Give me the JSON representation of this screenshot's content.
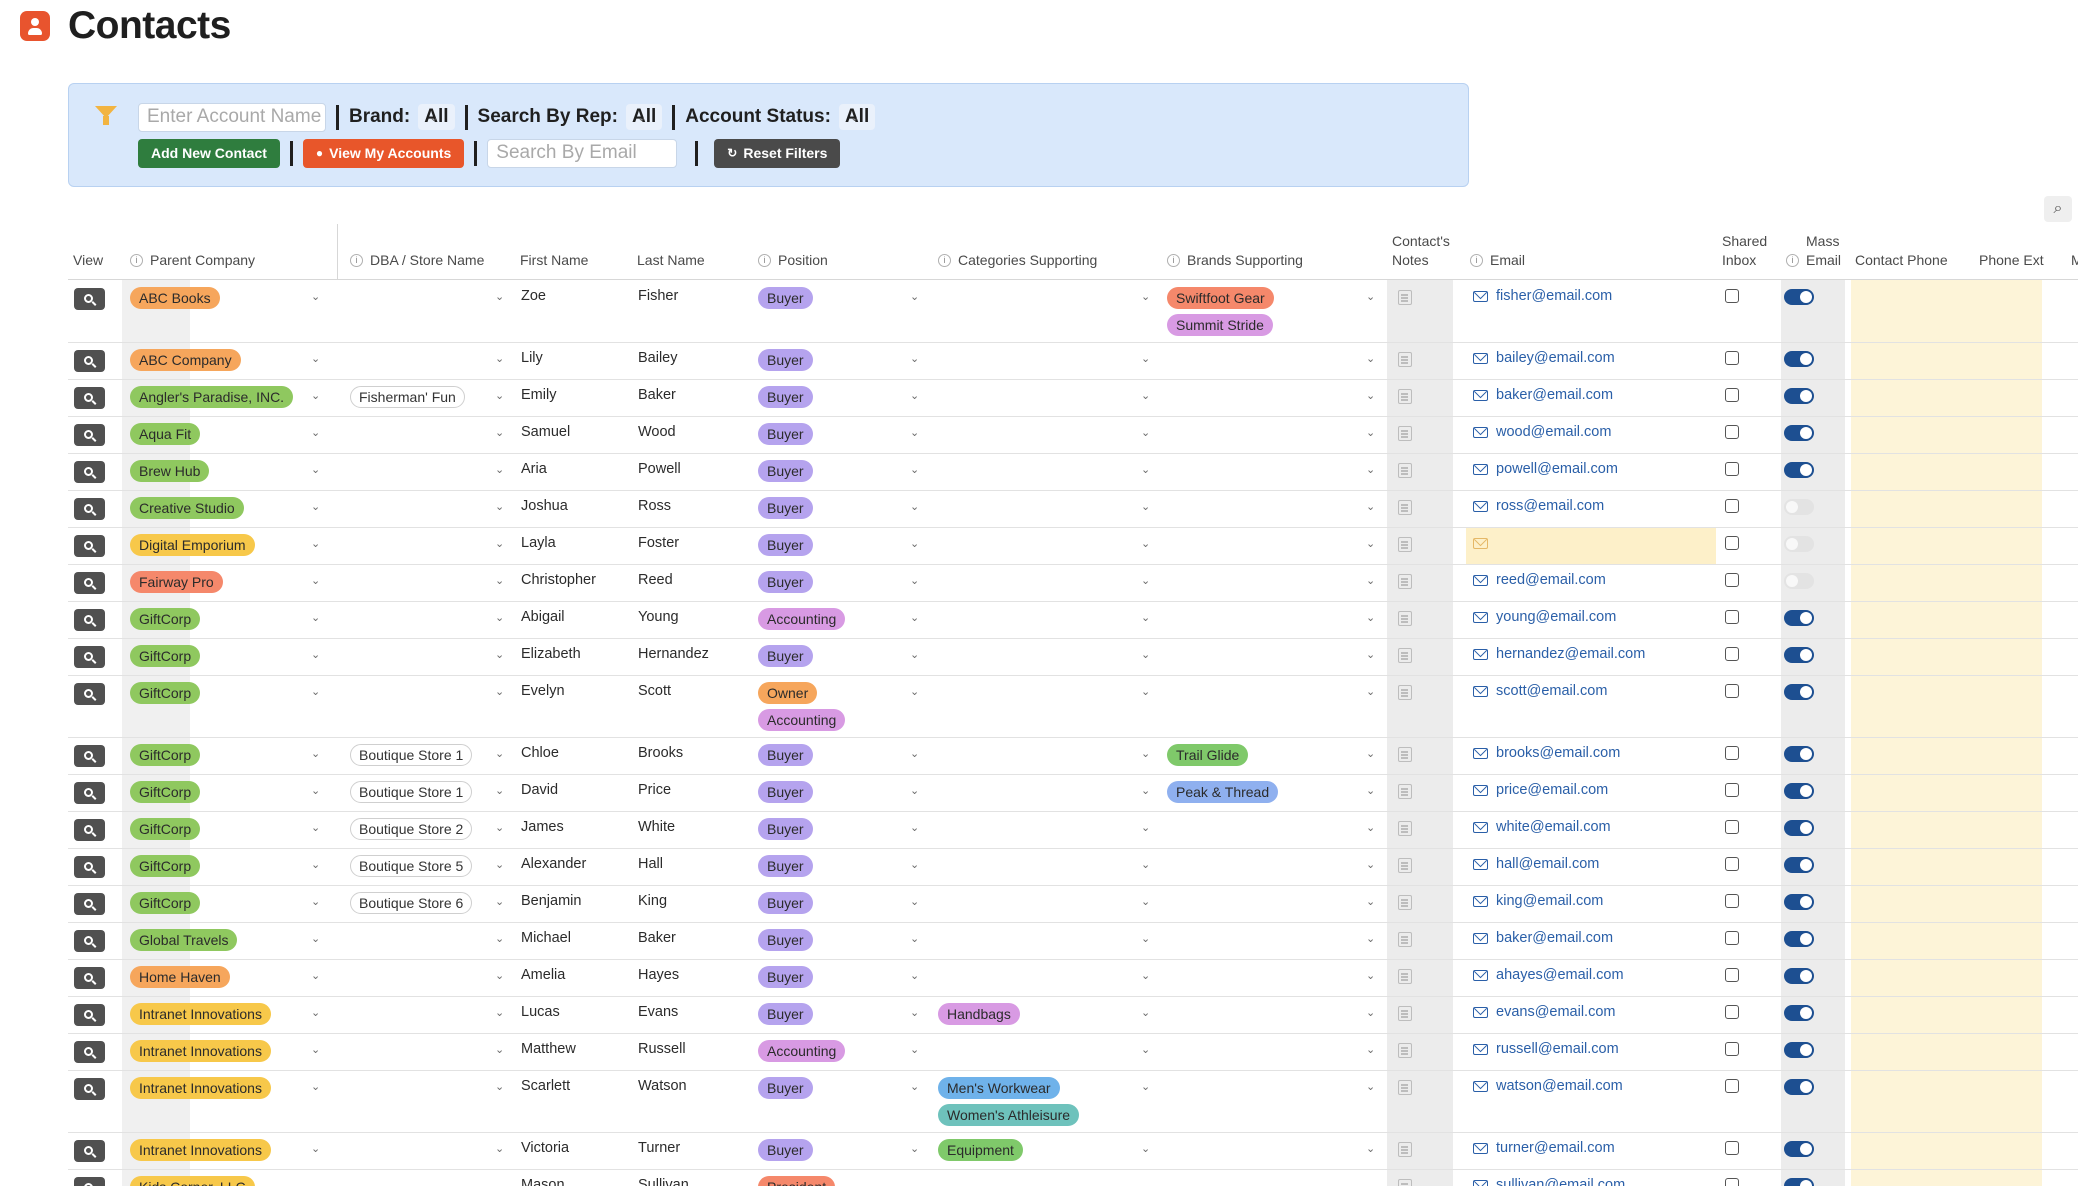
{
  "app": {
    "title": "Contacts",
    "icon": "contact-icon"
  },
  "filters": {
    "account_placeholder": "Enter Account Name",
    "brand_label": "Brand:",
    "brand_value": "All",
    "rep_label": "Search By Rep:",
    "rep_value": "All",
    "status_label": "Account Status:",
    "status_value": "All",
    "add_contact": "Add New Contact",
    "view_accounts": "View My Accounts",
    "email_placeholder": "Search By Email",
    "reset": "Reset Filters"
  },
  "columns": {
    "view": "View",
    "parent": "Parent Company",
    "dba": "DBA / Store Name",
    "first": "First Name",
    "last": "Last Name",
    "position": "Position",
    "categories": "Categories Supporting",
    "brands": "Brands Supporting",
    "notes_1": "Contact's",
    "notes_2": "Notes",
    "email": "Email",
    "shared_1": "Shared",
    "shared_2": "Inbox",
    "mass_1": "Mass",
    "mass_2": "Email",
    "phone": "Contact Phone",
    "ext": "Phone Ext",
    "next": "M"
  },
  "colors": {
    "orange": "#f6a65c",
    "yellow": "#f7c84a",
    "green": "#8fc85f",
    "salmon": "#f5886b",
    "purple": "#b5a3ee",
    "magenta": "#d89ae3",
    "blue": "#8fb0ef",
    "sky": "#6fb2ea",
    "teal": "#6ec2bc",
    "lime": "#7fc96a"
  },
  "rows": [
    {
      "parent": "ABC Books",
      "parent_color": "orange",
      "dba": "",
      "first": "Zoe",
      "last": "Fisher",
      "position": [
        {
          "t": "Buyer",
          "c": "purple"
        }
      ],
      "categories": [],
      "brands": [
        {
          "t": "Swiftfoot Gear",
          "c": "salmon"
        },
        {
          "t": "Summit Stride",
          "c": "magenta"
        }
      ],
      "email": "fisher@email.com",
      "mass": true
    },
    {
      "parent": "ABC Company",
      "parent_color": "orange",
      "dba": "",
      "first": "Lily",
      "last": "Bailey",
      "position": [
        {
          "t": "Buyer",
          "c": "purple"
        }
      ],
      "categories": [],
      "brands": [],
      "email": "bailey@email.com",
      "mass": true
    },
    {
      "parent": "Angler's Paradise, INC.",
      "parent_color": "green",
      "dba": "Fisherman' Fun",
      "first": "Emily",
      "last": "Baker",
      "position": [
        {
          "t": "Buyer",
          "c": "purple"
        }
      ],
      "categories": [],
      "brands": [],
      "email": "baker@email.com",
      "mass": true
    },
    {
      "parent": "Aqua Fit",
      "parent_color": "green",
      "dba": "",
      "first": "Samuel",
      "last": "Wood",
      "position": [
        {
          "t": "Buyer",
          "c": "purple"
        }
      ],
      "categories": [],
      "brands": [],
      "email": "wood@email.com",
      "mass": true
    },
    {
      "parent": "Brew Hub",
      "parent_color": "green",
      "dba": "",
      "first": "Aria",
      "last": "Powell",
      "position": [
        {
          "t": "Buyer",
          "c": "purple"
        }
      ],
      "categories": [],
      "brands": [],
      "email": "powell@email.com",
      "mass": true
    },
    {
      "parent": "Creative Studio",
      "parent_color": "green",
      "dba": "",
      "first": "Joshua",
      "last": "Ross",
      "position": [
        {
          "t": "Buyer",
          "c": "purple"
        }
      ],
      "categories": [],
      "brands": [],
      "email": "ross@email.com",
      "mass": false
    },
    {
      "parent": "Digital Emporium",
      "parent_color": "yellow",
      "dba": "",
      "first": "Layla",
      "last": "Foster",
      "position": [
        {
          "t": "Buyer",
          "c": "purple"
        }
      ],
      "categories": [],
      "brands": [],
      "email": "",
      "mass": false
    },
    {
      "parent": "Fairway Pro",
      "parent_color": "salmon",
      "dba": "",
      "first": "Christopher",
      "last": "Reed",
      "position": [
        {
          "t": "Buyer",
          "c": "purple"
        }
      ],
      "categories": [],
      "brands": [],
      "email": "reed@email.com",
      "mass": false
    },
    {
      "parent": "GiftCorp",
      "parent_color": "green",
      "dba": "",
      "first": "Abigail",
      "last": "Young",
      "position": [
        {
          "t": "Accounting",
          "c": "magenta"
        }
      ],
      "categories": [],
      "brands": [],
      "email": "young@email.com",
      "mass": true
    },
    {
      "parent": "GiftCorp",
      "parent_color": "green",
      "dba": "",
      "first": "Elizabeth",
      "last": "Hernandez",
      "position": [
        {
          "t": "Buyer",
          "c": "purple"
        }
      ],
      "categories": [],
      "brands": [],
      "email": "hernandez@email.com",
      "mass": true
    },
    {
      "parent": "GiftCorp",
      "parent_color": "green",
      "dba": "",
      "first": "Evelyn",
      "last": "Scott",
      "position": [
        {
          "t": "Owner",
          "c": "orange"
        },
        {
          "t": "Accounting",
          "c": "magenta"
        }
      ],
      "categories": [],
      "brands": [],
      "email": "scott@email.com",
      "mass": true
    },
    {
      "parent": "GiftCorp",
      "parent_color": "green",
      "dba": "Boutique Store 1",
      "first": "Chloe",
      "last": "Brooks",
      "position": [
        {
          "t": "Buyer",
          "c": "purple"
        }
      ],
      "categories": [],
      "brands": [
        {
          "t": "Trail Glide",
          "c": "lime"
        }
      ],
      "email": "brooks@email.com",
      "mass": true
    },
    {
      "parent": "GiftCorp",
      "parent_color": "green",
      "dba": "Boutique Store 1",
      "first": "David",
      "last": "Price",
      "position": [
        {
          "t": "Buyer",
          "c": "purple"
        }
      ],
      "categories": [],
      "brands": [
        {
          "t": "Peak & Thread",
          "c": "blue"
        }
      ],
      "email": "price@email.com",
      "mass": true
    },
    {
      "parent": "GiftCorp",
      "parent_color": "green",
      "dba": "Boutique Store 2",
      "first": "James",
      "last": "White",
      "position": [
        {
          "t": "Buyer",
          "c": "purple"
        }
      ],
      "categories": [],
      "brands": [],
      "email": "white@email.com",
      "mass": true
    },
    {
      "parent": "GiftCorp",
      "parent_color": "green",
      "dba": "Boutique Store 5",
      "first": "Alexander",
      "last": "Hall",
      "position": [
        {
          "t": "Buyer",
          "c": "purple"
        }
      ],
      "categories": [],
      "brands": [],
      "email": "hall@email.com",
      "mass": true
    },
    {
      "parent": "GiftCorp",
      "parent_color": "green",
      "dba": "Boutique Store 6",
      "first": "Benjamin",
      "last": "King",
      "position": [
        {
          "t": "Buyer",
          "c": "purple"
        }
      ],
      "categories": [],
      "brands": [],
      "email": "king@email.com",
      "mass": true
    },
    {
      "parent": "Global Travels",
      "parent_color": "green",
      "dba": "",
      "first": "Michael",
      "last": "Baker",
      "position": [
        {
          "t": "Buyer",
          "c": "purple"
        }
      ],
      "categories": [],
      "brands": [],
      "email": "baker@email.com",
      "mass": true
    },
    {
      "parent": "Home Haven",
      "parent_color": "orange",
      "dba": "",
      "first": "Amelia",
      "last": "Hayes",
      "position": [
        {
          "t": "Buyer",
          "c": "purple"
        }
      ],
      "categories": [],
      "brands": [],
      "email": "ahayes@email.com",
      "mass": true
    },
    {
      "parent": "Intranet Innovations",
      "parent_color": "yellow",
      "dba": "",
      "first": "Lucas",
      "last": "Evans",
      "position": [
        {
          "t": "Buyer",
          "c": "purple"
        }
      ],
      "categories": [
        {
          "t": "Handbags",
          "c": "magenta"
        }
      ],
      "brands": [],
      "email": "evans@email.com",
      "mass": true
    },
    {
      "parent": "Intranet Innovations",
      "parent_color": "yellow",
      "dba": "",
      "first": "Matthew",
      "last": "Russell",
      "position": [
        {
          "t": "Accounting",
          "c": "magenta"
        }
      ],
      "categories": [],
      "brands": [],
      "email": "russell@email.com",
      "mass": true
    },
    {
      "parent": "Intranet Innovations",
      "parent_color": "yellow",
      "dba": "",
      "first": "Scarlett",
      "last": "Watson",
      "position": [
        {
          "t": "Buyer",
          "c": "purple"
        }
      ],
      "categories": [
        {
          "t": "Men's Workwear",
          "c": "sky"
        },
        {
          "t": "Women's Athleisure",
          "c": "teal"
        }
      ],
      "brands": [],
      "email": "watson@email.com",
      "mass": true
    },
    {
      "parent": "Intranet Innovations",
      "parent_color": "yellow",
      "dba": "",
      "first": "Victoria",
      "last": "Turner",
      "position": [
        {
          "t": "Buyer",
          "c": "purple"
        }
      ],
      "categories": [
        {
          "t": "Equipment",
          "c": "lime"
        }
      ],
      "brands": [],
      "email": "turner@email.com",
      "mass": true
    },
    {
      "parent": "Kids Corner, LLC",
      "parent_color": "yellow",
      "dba": "",
      "first": "Mason",
      "last": "Sullivan",
      "position": [
        {
          "t": "President",
          "c": "salmon"
        }
      ],
      "categories": [],
      "brands": [],
      "email": "sullivan@email.com",
      "mass": true
    }
  ]
}
